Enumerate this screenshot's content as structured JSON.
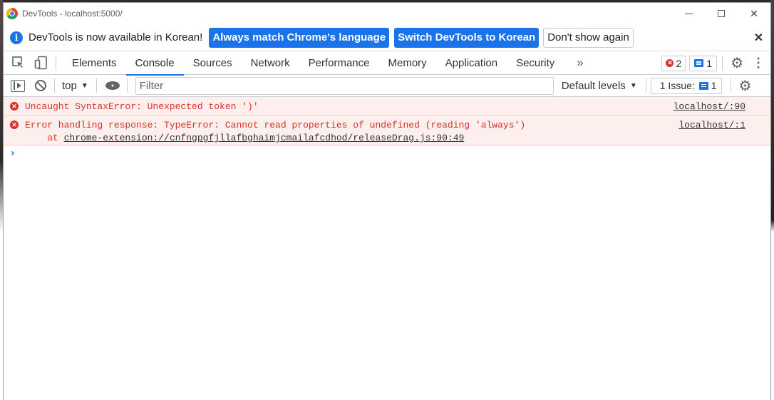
{
  "window": {
    "title": "DevTools - localhost:5000/",
    "close_glyph": "✕"
  },
  "infobar": {
    "message": "DevTools is now available in Korean!",
    "match_language_button": "Always match Chrome's language",
    "switch_korean_button": "Switch DevTools to Korean",
    "dont_show_button": "Don't show again",
    "close_glyph": "✕"
  },
  "tabs": [
    {
      "label": "Elements"
    },
    {
      "label": "Console",
      "active": true
    },
    {
      "label": "Sources"
    },
    {
      "label": "Network"
    },
    {
      "label": "Performance"
    },
    {
      "label": "Memory"
    },
    {
      "label": "Application"
    },
    {
      "label": "Security"
    }
  ],
  "tabbar": {
    "more_glyph": "»",
    "error_count": "2",
    "message_count": "1"
  },
  "console_toolbar": {
    "context": "top",
    "filter_placeholder": "Filter",
    "levels": "Default levels",
    "issues_label": "1 Issue:",
    "issues_count": "1"
  },
  "messages": [
    {
      "text": "Uncaught SyntaxError: Unexpected token ')'",
      "source": "localhost/:90"
    },
    {
      "text": "Error handling response: TypeError: Cannot read properties of undefined (reading 'always')",
      "stack_prefix": "    at ",
      "stack_link": "chrome-extension://cnfngpgfjllafbghaimjcmailafcdhod/releaseDrag.js:90:49",
      "source": "localhost/:1"
    }
  ],
  "prompt_glyph": "›",
  "colors": {
    "accent": "#1a73e8",
    "error": "#d93025",
    "error_bg": "#fdefee"
  }
}
